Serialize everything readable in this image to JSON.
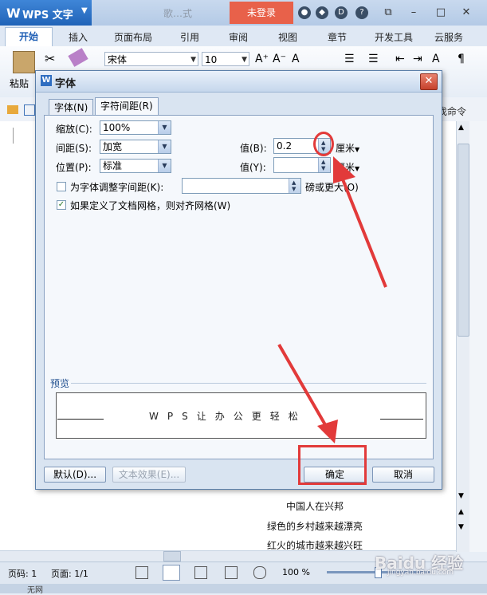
{
  "app": {
    "name": "WPS 文字",
    "doc_title": "歌…式",
    "login": "未登录"
  },
  "ribbon_tabs": [
    "开始",
    "插入",
    "页面布局",
    "引用",
    "审阅",
    "视图",
    "章节",
    "开发工具",
    "云服务"
  ],
  "ribbon": {
    "paste_label": "粘贴",
    "font_name": "宋体",
    "font_size": "10",
    "cmd_hint": "找命令"
  },
  "document": {
    "lines": [
      "中国人在兴邦",
      "绿色的乡村越来越漂亮",
      "红火的城市越来越兴旺"
    ]
  },
  "status": {
    "page_num": "页码: 1",
    "page_total": "页面: 1/1",
    "zoom": "100 %",
    "bottom": "无网"
  },
  "watermark": {
    "main": "Baidu 经验",
    "sub": "jingyan.baidu.com"
  },
  "dialog": {
    "title": "字体",
    "tab_font": "字体(N)",
    "tab_spacing": "字符间距(R)",
    "scale_label": "缩放(C):",
    "scale_value": "100%",
    "spacing_label": "间距(S):",
    "spacing_value": "加宽",
    "position_label": "位置(P):",
    "position_value": "标准",
    "spacing_amount_label": "值(B):",
    "spacing_amount_value": "0.2",
    "spacing_unit": "厘米",
    "position_amount_label": "值(Y):",
    "position_amount_value": "",
    "position_unit": "厘米",
    "kerning_label": "为字体调整字间距(K):",
    "kerning_value": "",
    "kerning_suffix": "磅或更大(O)",
    "kerning_checked": false,
    "grid_label": "如果定义了文档网格，则对齐网格(W)",
    "grid_checked": true,
    "preview_label": "预览",
    "preview_text": "WPS让办公更轻松",
    "btn_default": "默认(D)...",
    "btn_text_effect": "文本效果(E)...",
    "btn_ok": "确定",
    "btn_cancel": "取消"
  },
  "colors": {
    "accent": "#2063b8",
    "login": "#e8614a",
    "annotation": "#e23a3a"
  }
}
